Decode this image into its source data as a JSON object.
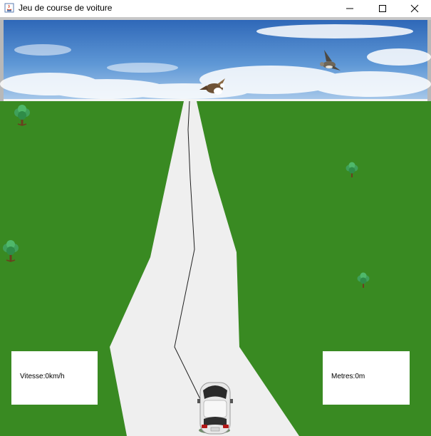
{
  "window": {
    "title": "Jeu de course de voiture",
    "minimize_icon": "minimize-icon",
    "maximize_icon": "maximize-icon",
    "close_icon": "close-icon"
  },
  "hud": {
    "speed_text": "Vitesse:0km/h",
    "distance_text": "Metres:0m"
  },
  "colors": {
    "sky": "#4a86c8",
    "grass": "#398a22",
    "road": "#efefef",
    "hud_bg": "#ffffff"
  }
}
